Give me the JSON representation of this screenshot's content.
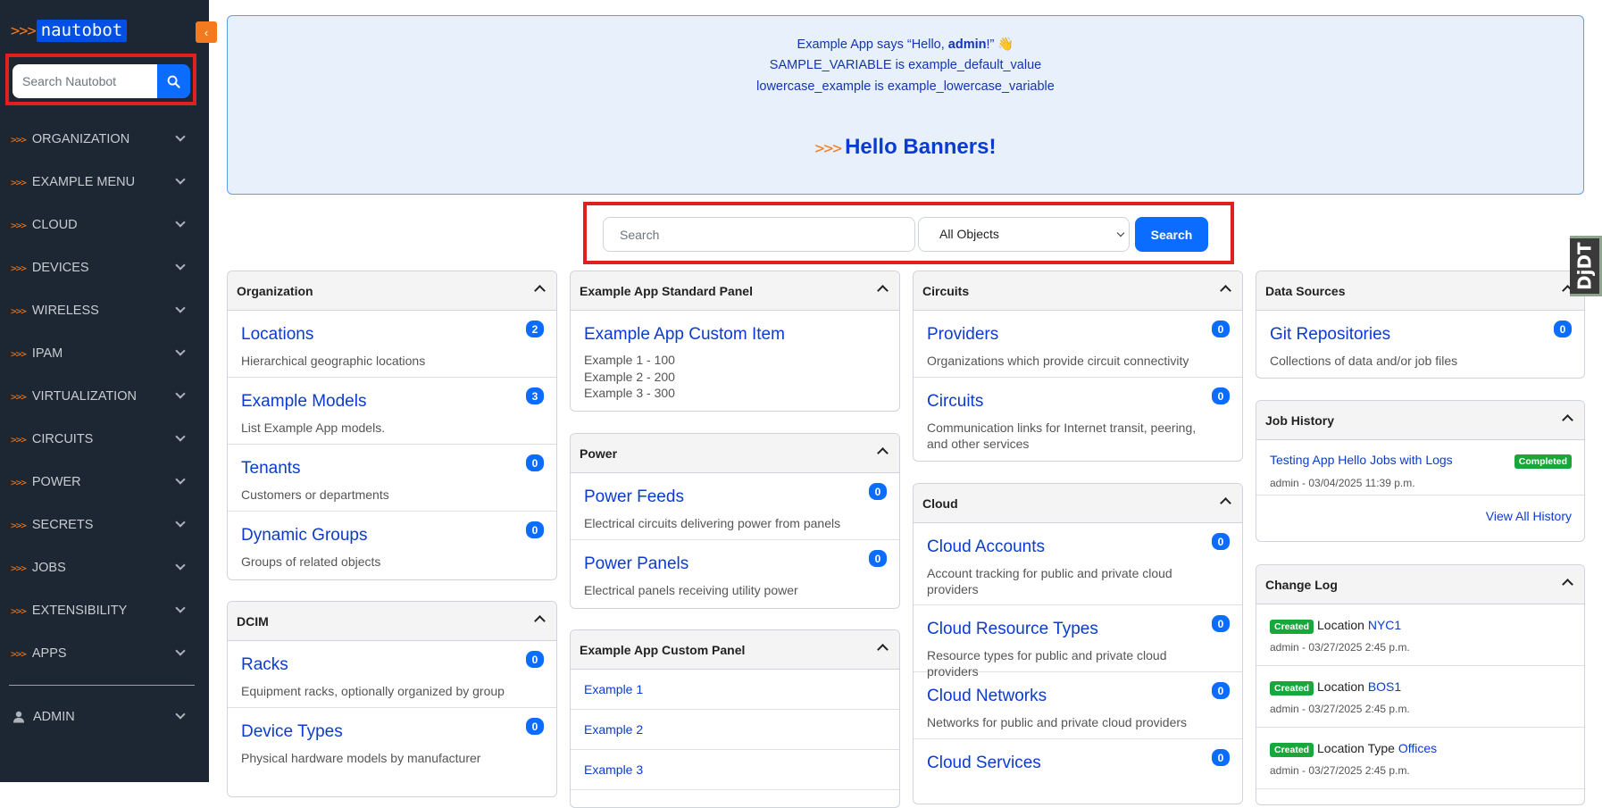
{
  "brand": {
    "chevrons": ">>>",
    "name": "nautobot"
  },
  "sidebar": {
    "search_placeholder": "Search Nautobot",
    "items": [
      {
        "label": "ORGANIZATION"
      },
      {
        "label": "EXAMPLE MENU"
      },
      {
        "label": "CLOUD"
      },
      {
        "label": "DEVICES"
      },
      {
        "label": "WIRELESS"
      },
      {
        "label": "IPAM"
      },
      {
        "label": "VIRTUALIZATION"
      },
      {
        "label": "CIRCUITS"
      },
      {
        "label": "POWER"
      },
      {
        "label": "SECRETS"
      },
      {
        "label": "JOBS"
      },
      {
        "label": "EXTENSIBILITY"
      },
      {
        "label": "APPS"
      }
    ],
    "admin_label": "ADMIN"
  },
  "banner": {
    "line1_pre": "Example App says “Hello, ",
    "line1_user": "admin",
    "line1_post": "!” 👋",
    "line2": "SAMPLE_VARIABLE is example_default_value",
    "line3": "lowercase_example is example_lowercase_variable",
    "hello_chevrons": ">>>",
    "hello_text": "Hello Banners!"
  },
  "search": {
    "placeholder": "Search",
    "select_value": "All Objects",
    "button_label": "Search"
  },
  "panels": {
    "organization": {
      "title": "Organization",
      "items": [
        {
          "title": "Locations",
          "desc": "Hierarchical geographic locations",
          "count": "2"
        },
        {
          "title": "Example Models",
          "desc": "List Example App models.",
          "count": "3"
        },
        {
          "title": "Tenants",
          "desc": "Customers or departments",
          "count": "0"
        },
        {
          "title": "Dynamic Groups",
          "desc": "Groups of related objects",
          "count": "0"
        }
      ]
    },
    "dcim": {
      "title": "DCIM",
      "items": [
        {
          "title": "Racks",
          "desc": "Equipment racks, optionally organized by group",
          "count": "0"
        },
        {
          "title": "Device Types",
          "desc": "Physical hardware models by manufacturer",
          "count": "0"
        }
      ]
    },
    "example_standard": {
      "title": "Example App Standard Panel",
      "item_title": "Example App Custom Item",
      "lines": [
        "Example 1 - 100",
        "Example 2 - 200",
        "Example 3 - 300"
      ]
    },
    "power": {
      "title": "Power",
      "items": [
        {
          "title": "Power Feeds",
          "desc": "Electrical circuits delivering power from panels",
          "count": "0"
        },
        {
          "title": "Power Panels",
          "desc": "Electrical panels receiving utility power",
          "count": "0"
        }
      ]
    },
    "example_custom": {
      "title": "Example App Custom Panel",
      "links": [
        "Example 1",
        "Example 2",
        "Example 3"
      ]
    },
    "circuits": {
      "title": "Circuits",
      "items": [
        {
          "title": "Providers",
          "desc": "Organizations which provide circuit connectivity",
          "count": "0"
        },
        {
          "title": "Circuits",
          "desc": "Communication links for Internet transit, peering, and other services",
          "count": "0"
        }
      ]
    },
    "cloud": {
      "title": "Cloud",
      "items": [
        {
          "title": "Cloud Accounts",
          "desc": "Account tracking for public and private cloud providers",
          "count": "0"
        },
        {
          "title": "Cloud Resource Types",
          "desc": "Resource types for public and private cloud providers",
          "count": "0"
        },
        {
          "title": "Cloud Networks",
          "desc": "Networks for public and private cloud providers",
          "count": "0"
        },
        {
          "title": "Cloud Services",
          "desc": "",
          "count": "0"
        }
      ]
    },
    "data_sources": {
      "title": "Data Sources",
      "items": [
        {
          "title": "Git Repositories",
          "desc": "Collections of data and/or job files",
          "count": "0"
        }
      ]
    },
    "job_history": {
      "title": "Job History",
      "job_name": "Testing App Hello Jobs with Logs",
      "status": "Completed",
      "meta": "admin - 03/04/2025 11:39 p.m.",
      "view_all": "View All History"
    },
    "change_log": {
      "title": "Change Log",
      "entries": [
        {
          "action": "Created",
          "type": "Location",
          "object": "NYC1",
          "meta": "admin - 03/27/2025 2:45 p.m."
        },
        {
          "action": "Created",
          "type": "Location",
          "object": "BOS1",
          "meta": "admin - 03/27/2025 2:45 p.m."
        },
        {
          "action": "Created",
          "type": "Location Type",
          "object": "Offices",
          "meta": "admin - 03/27/2025 2:45 p.m."
        }
      ]
    }
  },
  "debug_toolbar": {
    "label": "DjDT"
  }
}
